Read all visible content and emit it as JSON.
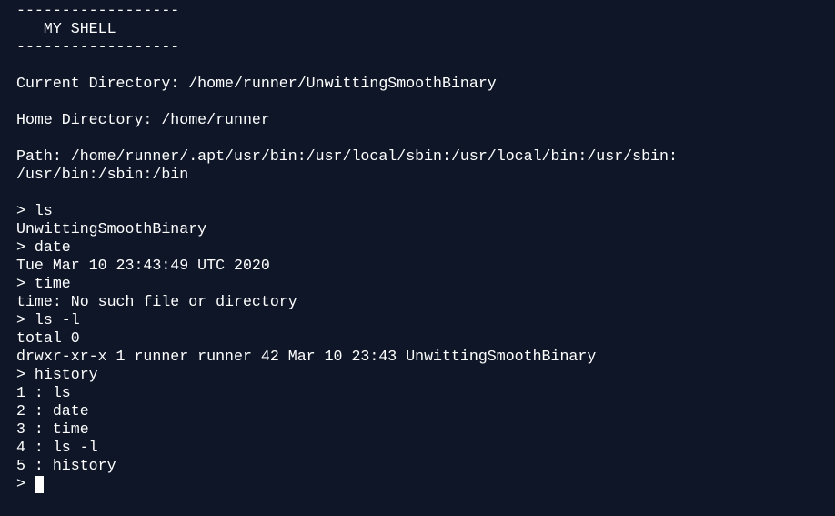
{
  "banner": {
    "top_rule": "------------------",
    "title": "   MY SHELL",
    "bottom_rule": "------------------"
  },
  "info": {
    "current_directory": "Current Directory: /home/runner/UnwittingSmoothBinary",
    "home_directory": "Home Directory: /home/runner",
    "path_line1": "Path: /home/runner/.apt/usr/bin:/usr/local/sbin:/usr/local/bin:/usr/sbin:",
    "path_line2": "/usr/bin:/sbin:/bin"
  },
  "session": [
    "> ls",
    "UnwittingSmoothBinary",
    "> date",
    "Tue Mar 10 23:43:49 UTC 2020",
    "> time",
    "time: No such file or directory",
    "> ls -l",
    "total 0",
    "drwxr-xr-x 1 runner runner 42 Mar 10 23:43 UnwittingSmoothBinary",
    "> history",
    "1 : ls",
    "2 : date",
    "3 : time",
    "4 : ls -l",
    "5 : history"
  ],
  "prompt": "> ",
  "colors": {
    "background": "#0e1628",
    "text": "#ffffff"
  }
}
